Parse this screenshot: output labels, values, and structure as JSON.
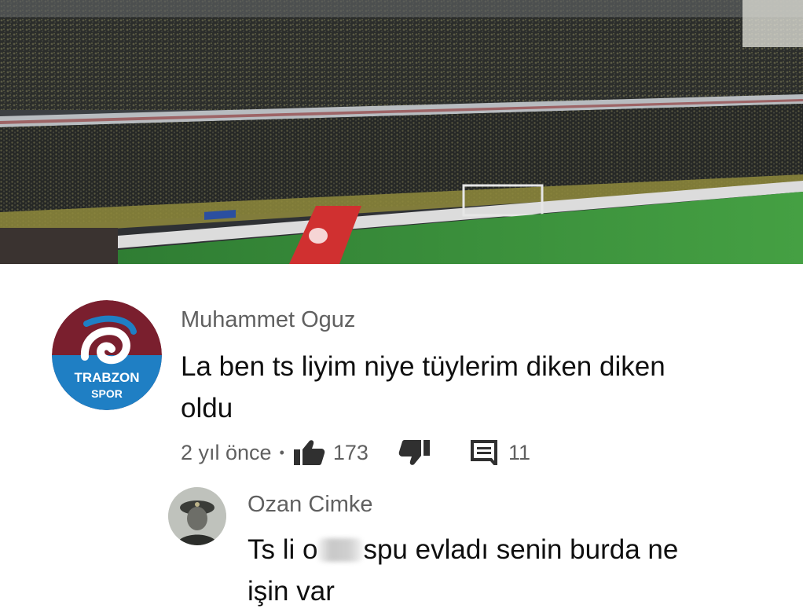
{
  "comment": {
    "author": "Muhammet Oguz",
    "text_line1": "La ben ts liyim niye tüylerim diken diken",
    "text_line2": "oldu",
    "time": "2 yıl önce",
    "likes": "173",
    "replies": "11",
    "avatar_text_top": "TRABZON",
    "avatar_text_bottom": "SPOR"
  },
  "reply": {
    "author": "Ozan Cimke",
    "text_before_blur": "Ts li o",
    "text_after_blur": "spu evladı senin burda ne",
    "text_line2": "işin var"
  },
  "icons": {
    "like": "thumbs-up-icon",
    "dislike": "thumbs-down-icon",
    "reply": "comment-icon"
  },
  "colors": {
    "meta_text": "#606060",
    "comment_text": "#0f0f0f",
    "pitch": "#3b8f3a",
    "avatar_maroon": "#7a1f2e",
    "avatar_blue": "#1f7fc4"
  }
}
